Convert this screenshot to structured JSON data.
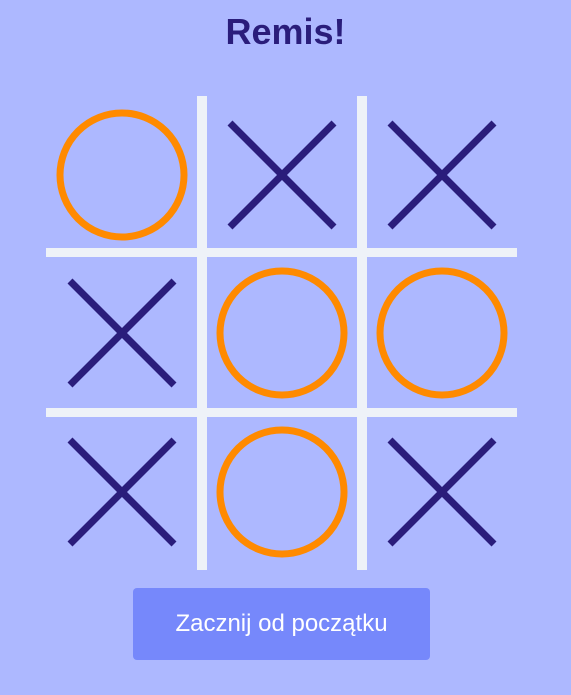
{
  "status": {
    "text": "Remis!"
  },
  "colors": {
    "background": "#adb8ff",
    "x_mark": "#2a1d7b",
    "o_mark": "#ff8a00",
    "grid": "#eef2f8",
    "button": "#7688fb",
    "button_text": "#ffffff"
  },
  "board": {
    "cells": [
      "O",
      "X",
      "X",
      "X",
      "O",
      "O",
      "X",
      "O",
      "X"
    ]
  },
  "controls": {
    "restart_label": "Zacznij od początku"
  }
}
